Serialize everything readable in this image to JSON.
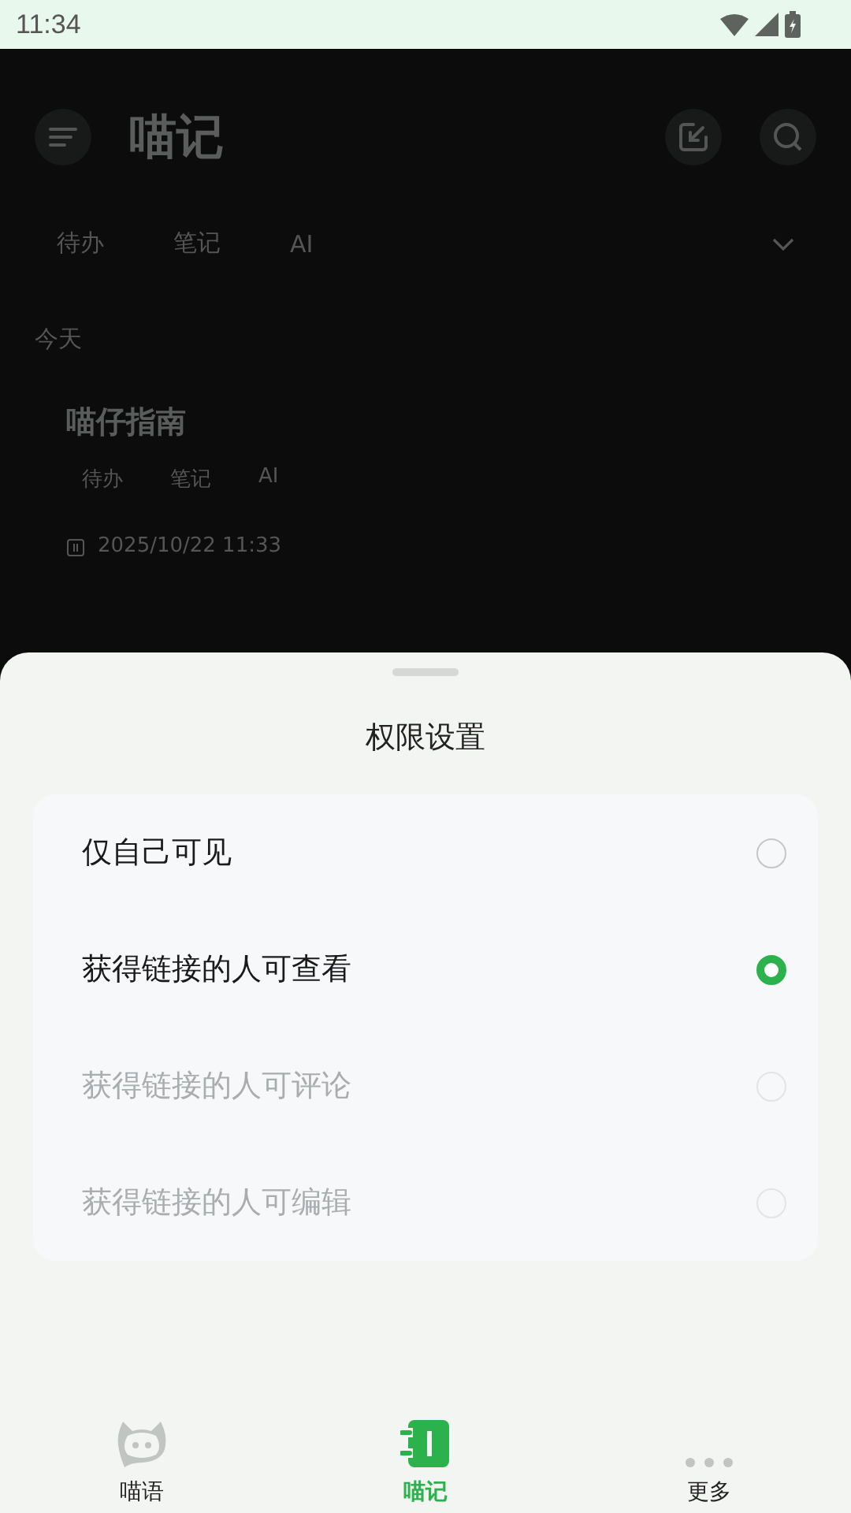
{
  "status_bar": {
    "time": "11:34"
  },
  "background": {
    "title": "喵记",
    "filters": [
      "待办",
      "笔记",
      "AI"
    ],
    "section": "今天",
    "note": {
      "title": "喵仔指南",
      "tags": [
        "待办",
        "笔记",
        "AI"
      ],
      "date": "2025/10/22 11:33"
    }
  },
  "sheet": {
    "title": "权限设置",
    "options": [
      {
        "label": "仅自己可见",
        "selected": false,
        "disabled": false
      },
      {
        "label": "获得链接的人可查看",
        "selected": true,
        "disabled": false
      },
      {
        "label": "获得链接的人可评论",
        "selected": false,
        "disabled": true
      },
      {
        "label": "获得链接的人可编辑",
        "selected": false,
        "disabled": true
      }
    ]
  },
  "bottom_nav": [
    {
      "label": "喵语",
      "kind": "cat",
      "selected": false
    },
    {
      "label": "喵记",
      "kind": "notebook",
      "selected": true
    },
    {
      "label": "更多",
      "kind": "more",
      "selected": false
    }
  ]
}
